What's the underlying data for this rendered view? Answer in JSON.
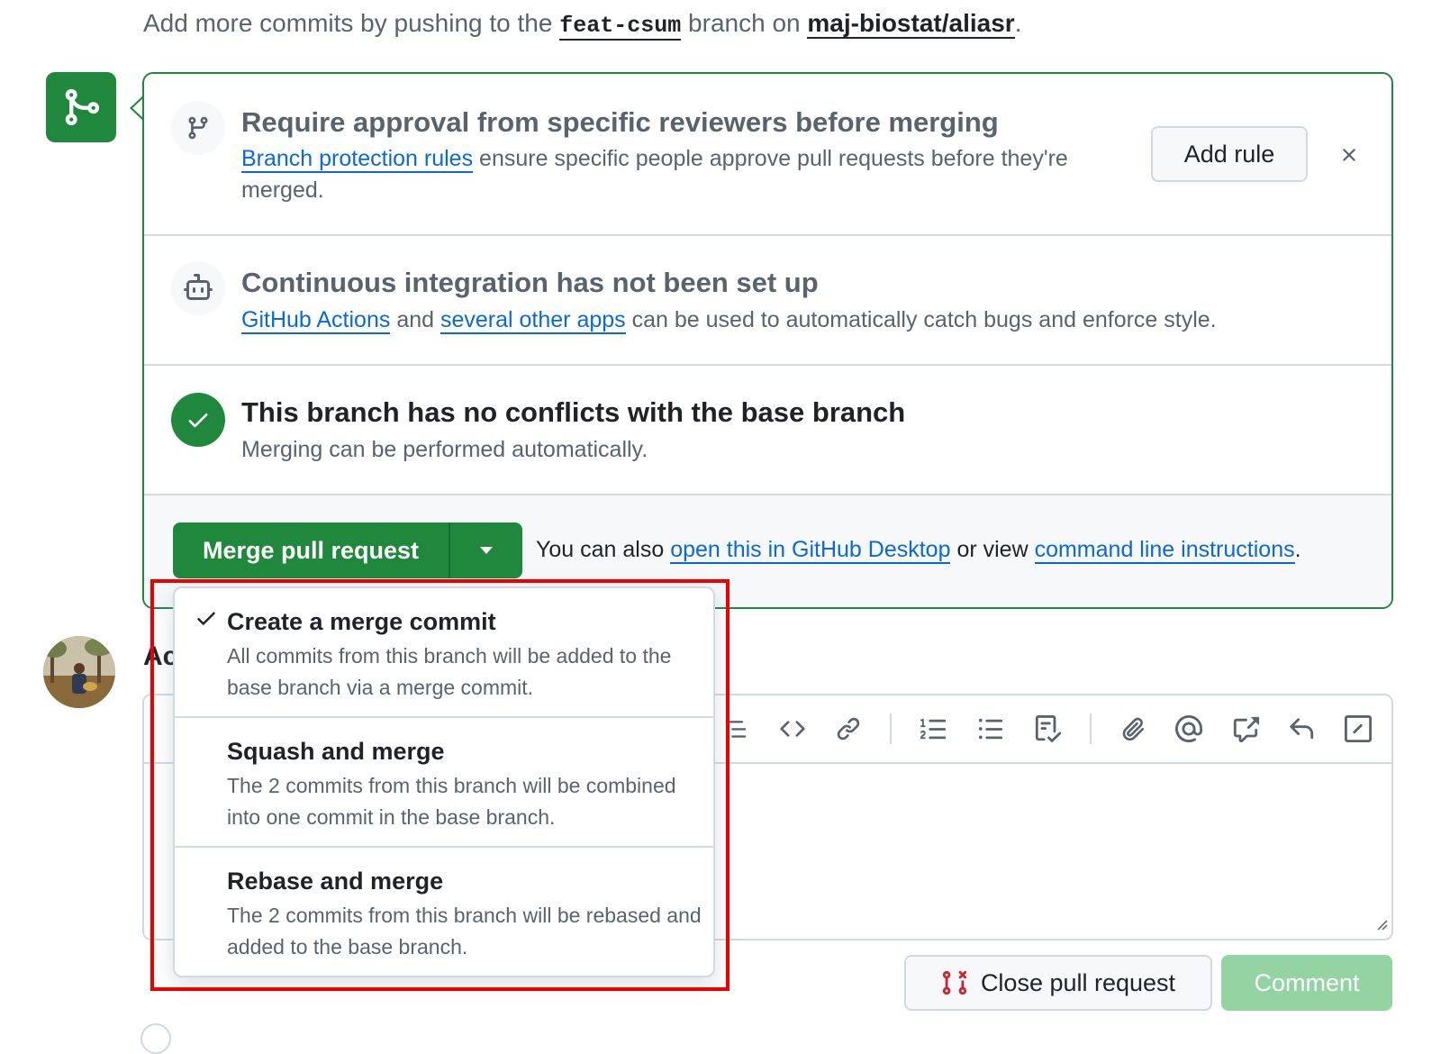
{
  "header": {
    "prefix": "Add more commits by pushing to the",
    "branch": "feat-csum",
    "middle": "branch on",
    "repo": "maj-biostat/aliasr",
    "suffix": "."
  },
  "approval": {
    "title": "Require approval from specific reviewers before merging",
    "link": "Branch protection rules",
    "text": "ensure specific people approve pull requests before they're merged.",
    "add_rule_label": "Add rule"
  },
  "ci": {
    "title": "Continuous integration has not been set up",
    "link1": "GitHub Actions",
    "and": "and",
    "link2": "several other apps",
    "text": "can be used to automatically catch bugs and enforce style."
  },
  "conflicts": {
    "title": "This branch has no conflicts with the base branch",
    "text": "Merging can be performed automatically."
  },
  "merge": {
    "button_label": "Merge pull request",
    "also_prefix": "You can also",
    "desktop_link": "open this in GitHub Desktop",
    "or_view": "or view",
    "cli_link": "command line instructions",
    "suffix": "."
  },
  "dropdown": {
    "items": [
      {
        "title": "Create a merge commit",
        "description": "All commits from this branch will be added to the base branch via a merge commit.",
        "selected": true
      },
      {
        "title": "Squash and merge",
        "description": "The 2 commits from this branch will be combined into one commit in the base branch.",
        "selected": false
      },
      {
        "title": "Rebase and merge",
        "description": "The 2 commits from this branch will be rebased and added to the base branch.",
        "selected": false
      }
    ]
  },
  "comment": {
    "heading_partial": "Ac",
    "close_label": "Close pull request",
    "comment_label": "Comment"
  },
  "colors": {
    "green": "#1f883d",
    "link_blue": "#0969da",
    "highlight_red": "#ee0000",
    "close_icon_red": "#cf222e",
    "comment_disabled": "#94d3a2"
  },
  "icons": {
    "badge": "git-merge-icon",
    "approval": "git-branch-icon",
    "ci": "robot-icon",
    "conflicts": "check-circle-icon"
  }
}
